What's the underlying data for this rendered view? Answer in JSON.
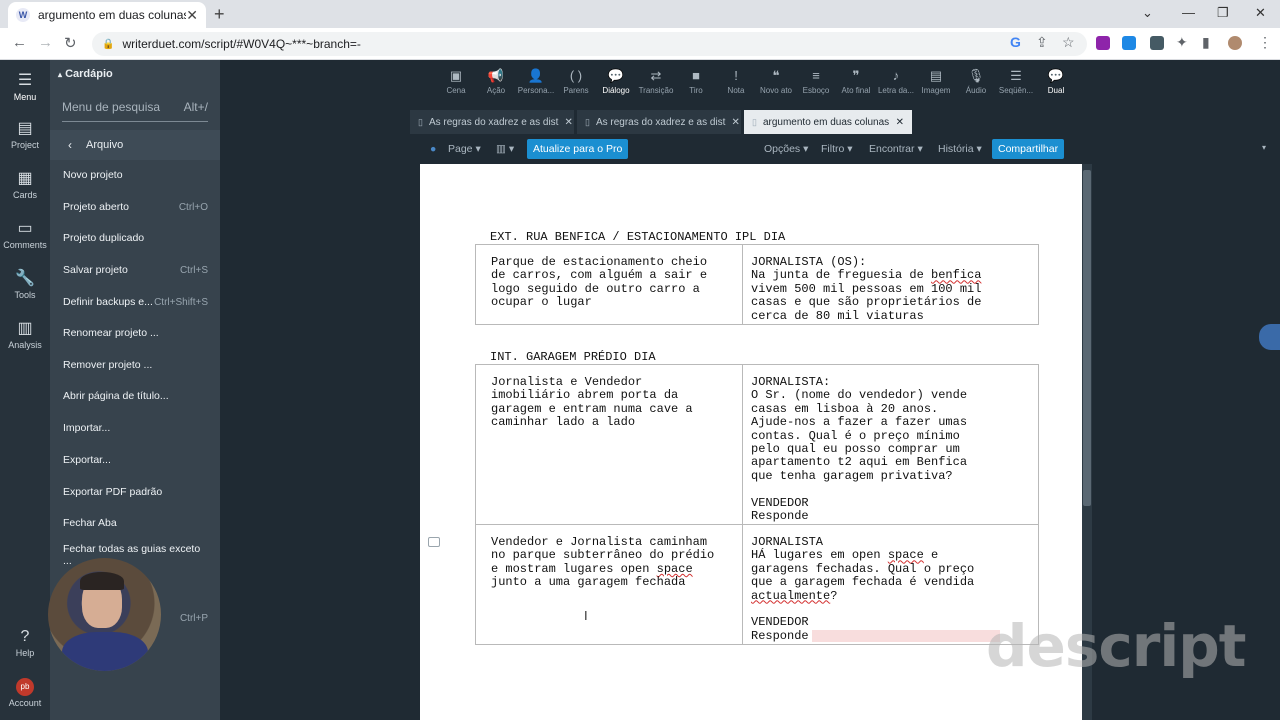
{
  "browser": {
    "tab_title": "argumento em duas colunas",
    "url": "writerduet.com/script/#W0V4Q~***~branch=-"
  },
  "rail": [
    {
      "label": "Menu",
      "icon": "hamburger-icon"
    },
    {
      "label": "Project",
      "icon": "project-icon"
    },
    {
      "label": "Cards",
      "icon": "cards-icon"
    },
    {
      "label": "Comments",
      "icon": "comments-icon"
    },
    {
      "label": "Tools",
      "icon": "wrench-icon"
    },
    {
      "label": "Analysis",
      "icon": "chart-icon"
    },
    {
      "label": "Help",
      "icon": "help-icon"
    },
    {
      "label": "Account",
      "icon": "avatar-icon",
      "avatar_text": "pb"
    }
  ],
  "menu": {
    "header": "Cardápio",
    "search_placeholder": "Menu de pesquisa",
    "search_shortcut": "Alt+/",
    "submenu_title": "Arquivo",
    "items": [
      {
        "label": "Novo projeto",
        "shortcut": ""
      },
      {
        "label": "Projeto aberto",
        "shortcut": "Ctrl+O"
      },
      {
        "label": "Projeto duplicado",
        "shortcut": ""
      },
      {
        "label": "Salvar projeto",
        "shortcut": "Ctrl+S"
      },
      {
        "label": "Definir backups e...",
        "shortcut": "Ctrl+Shift+S"
      },
      {
        "label": "Renomear projeto ...",
        "shortcut": ""
      },
      {
        "label": "Remover projeto ...",
        "shortcut": ""
      },
      {
        "label": "Abrir página de título...",
        "shortcut": ""
      },
      {
        "label": "Importar...",
        "shortcut": ""
      },
      {
        "label": "Exportar...",
        "shortcut": ""
      },
      {
        "label": "Exportar PDF padrão",
        "shortcut": ""
      },
      {
        "label": "Fechar Aba",
        "shortcut": ""
      },
      {
        "label": "Fechar todas as guias exceto ...",
        "shortcut": ""
      },
      {
        "label": "",
        "shortcut": "Ctrl+P"
      }
    ]
  },
  "toolbar": [
    {
      "label": "Cena",
      "glyph": "▣"
    },
    {
      "label": "Ação",
      "glyph": "📢"
    },
    {
      "label": "Persona...",
      "glyph": "👤"
    },
    {
      "label": "Parens",
      "glyph": "( )"
    },
    {
      "label": "Diálogo",
      "glyph": "💬",
      "active": true
    },
    {
      "label": "Transição",
      "glyph": "⇄"
    },
    {
      "label": "Tiro",
      "glyph": "■"
    },
    {
      "label": "Nota",
      "glyph": "!"
    },
    {
      "label": "Novo ato",
      "glyph": "❝"
    },
    {
      "label": "Esboço",
      "glyph": "≡"
    },
    {
      "label": "Ato final",
      "glyph": "❞"
    },
    {
      "label": "Letra da...",
      "glyph": "♪"
    },
    {
      "label": "Imagem",
      "glyph": "▤"
    },
    {
      "label": "Áudio",
      "glyph": "🎙"
    },
    {
      "label": "Seqüên...",
      "glyph": "☰"
    },
    {
      "label": "Dual",
      "glyph": "💬",
      "active": true
    }
  ],
  "doc_tabs": [
    {
      "label": "As regras do xadrez e as dist",
      "active": false
    },
    {
      "label": "As regras do xadrez e as dist",
      "active": false
    },
    {
      "label": "argumento em duas colunas",
      "active": true
    }
  ],
  "secondary": {
    "page_label": "Page",
    "upgrade_label": "Atualize para o Pro",
    "options_label": "Opções",
    "filter_label": "Filtro",
    "find_label": "Encontrar",
    "history_label": "História",
    "share_label": "Compartilhar"
  },
  "script": {
    "scene1_heading": "EXT. RUA BENFICA / ESTACIONAMENTO IPL DIA",
    "scene1_left": "Parque de estacionamento cheio\nde carros, com alguém a sair e\nlogo seguido de outro carro a\nocupar o lugar",
    "scene1_right_a": "JORNALISTA (OS):\nNa junta de freguesia de ",
    "scene1_right_b": "benfica",
    "scene1_right_c": "\nvivem 500 mil pessoas em 100 mil\ncasas e que são proprietários de\ncerca de 80 mil viaturas",
    "scene2_heading": "INT. GARAGEM PRÉDIO DIA",
    "scene2_left": "Jornalista e Vendedor\nimobiliário abrem porta da\ngaragem e entram numa cave a\ncaminhar lado a lado",
    "scene2_right": "JORNALISTA:\nO Sr. (nome do vendedor) vende\ncasas em lisboa à 20 anos.\nAjude-nos a fazer a fazer umas\ncontas. Qual é o preço mínimo\npelo qual eu posso comprar um\napartamento t2 aqui em Benfica\nque tenha garagem privativa?\n\nVENDEDOR\nResponde",
    "scene3_left_a": "Vendedor e Jornalista caminham\nno parque subterrâneo do prédio\ne mostram lugares open ",
    "scene3_left_b": "space",
    "scene3_left_c": "\njunto a uma garagem fechada",
    "scene3_right_a": "JORNALISTA\nHÁ lugares em open ",
    "scene3_right_b": "space",
    "scene3_right_c": " e\ngaragens fechadas. Qual o preço\nque a garagem fechada é vendida\n",
    "scene3_right_d": "actualmente",
    "scene3_right_e": "?\n\nVENDEDOR\nResponde"
  },
  "watermark": "descript"
}
